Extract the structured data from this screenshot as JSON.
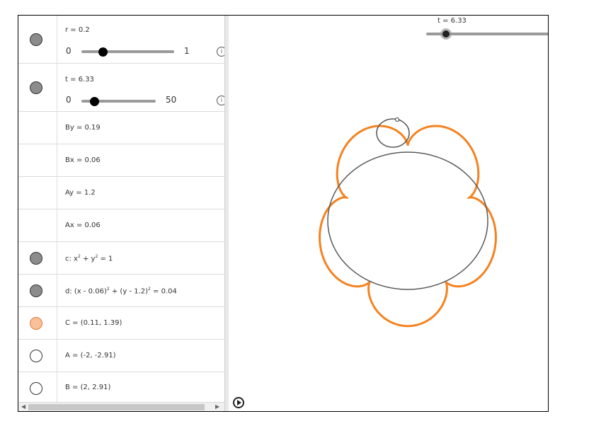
{
  "algebra": {
    "slider_r": {
      "label": "r = 0.2",
      "min": "0",
      "max": "1",
      "value": 0.2,
      "marble_color": "#8c8c8c"
    },
    "slider_t": {
      "label": "t = 6.33",
      "min": "0",
      "max": "50",
      "value": 6.33,
      "marble_color": "#8c8c8c"
    },
    "items": [
      {
        "text": "By = 0.19"
      },
      {
        "text": "Bx = 0.06"
      },
      {
        "text": "Ay = 1.2"
      },
      {
        "text": "Ax = 0.06"
      }
    ],
    "c_eq": {
      "prefix": "c: x",
      "mid": " + y",
      "suffix": " = 1",
      "marble_color": "#8c8c8c"
    },
    "d_eq": {
      "prefix": "d: (x - 0.06)",
      "mid": " + (y - 1.2)",
      "suffix": " = 0.04",
      "marble_color": "#8c8c8c"
    },
    "point_C": {
      "text": "C = (0.11, 1.39)",
      "marble_color": "#f9c09a"
    },
    "point_A": {
      "text": "A = (-2, -2.91)",
      "marble_color": "#ffffff"
    },
    "point_B": {
      "text": "B = (2, 2.91)",
      "marble_color": "#ffffff"
    }
  },
  "graphics": {
    "slider_label": "t = 6.33",
    "curve_color": "#f58220",
    "circle_color": "#595959"
  }
}
